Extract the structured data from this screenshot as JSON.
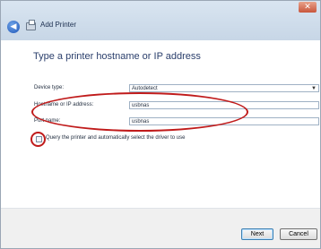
{
  "window": {
    "title": "Add Printer",
    "close_symbol": "✕",
    "back_symbol": "◀"
  },
  "page": {
    "heading": "Type a printer hostname or IP address"
  },
  "form": {
    "device_type_label": "Device type:",
    "device_type_value": "Autodetect",
    "hostname_label": "Hostname or IP address:",
    "hostname_value": "usbnas",
    "port_label": "Port name:",
    "port_value": "usbnas",
    "query_label": "Query the printer and automatically select the driver to use"
  },
  "buttons": {
    "next": "Next",
    "cancel": "Cancel"
  },
  "colors": {
    "annotation_red": "#c01b1b",
    "title_bar": "#d9e5f1"
  }
}
